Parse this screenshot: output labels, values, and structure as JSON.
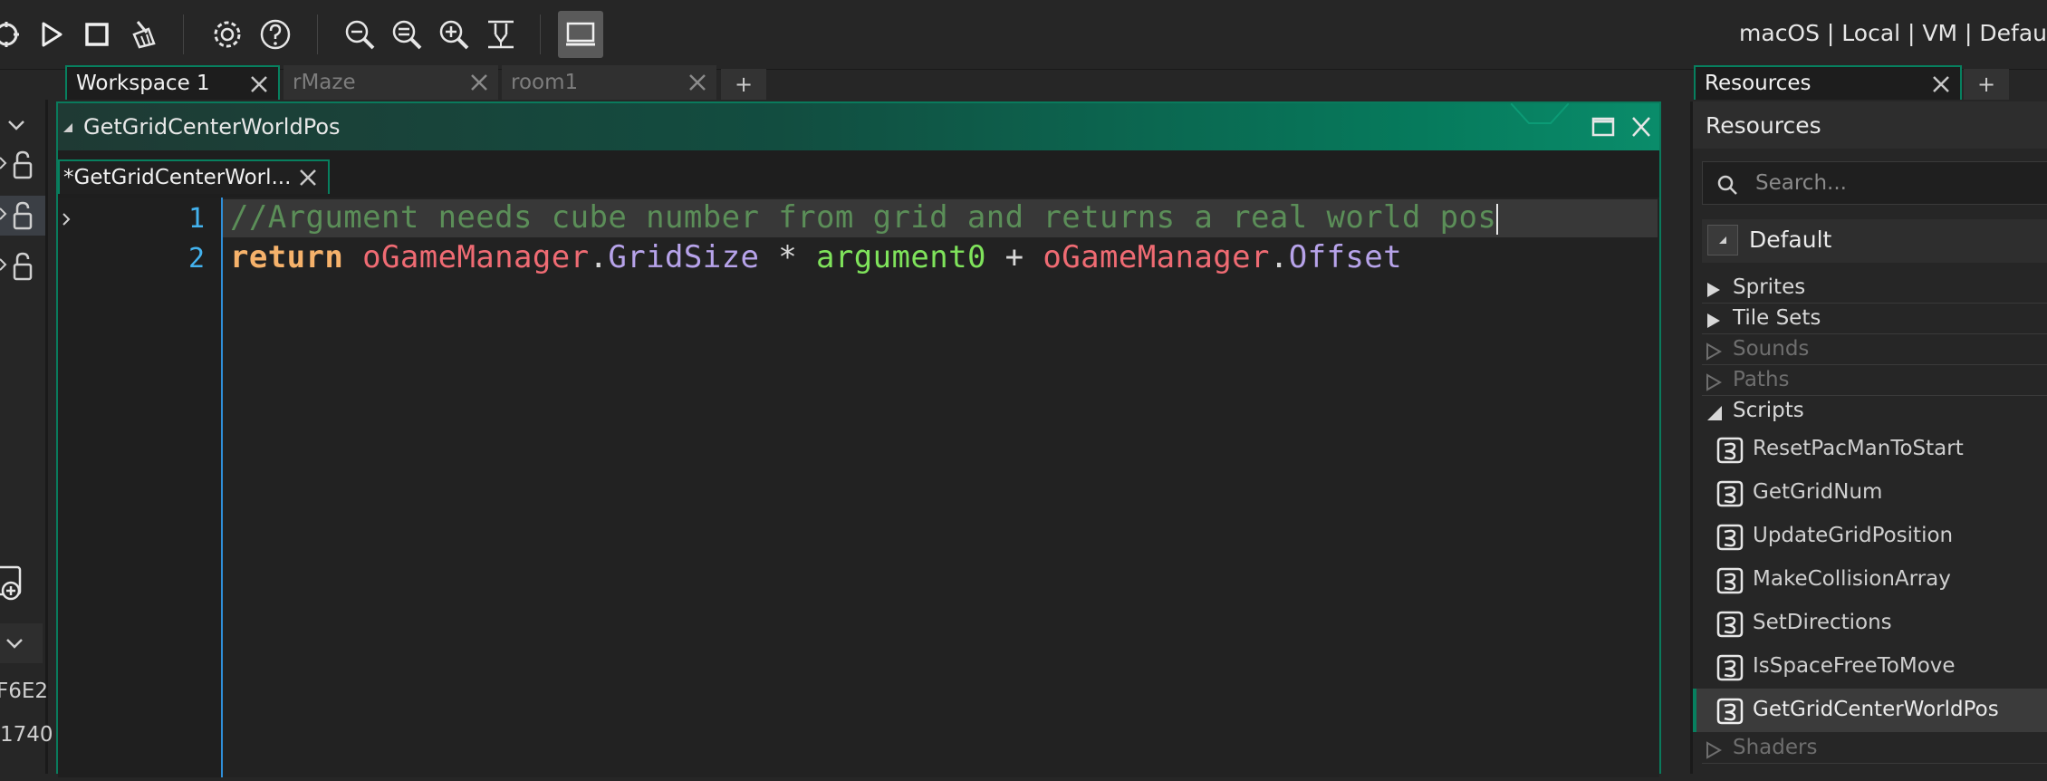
{
  "toolbar": {
    "buttons": [
      "debug-icon",
      "run-icon",
      "stop-icon",
      "clean-icon",
      "settings-icon",
      "help-icon",
      "zoom-out-icon",
      "zoom-reset-icon",
      "zoom-in-icon",
      "fit-icon",
      "monitor-icon"
    ],
    "target_label": "macOS | Local | VM | Defau"
  },
  "workspace_tabs": [
    {
      "label": "Workspace 1",
      "active": true
    },
    {
      "label": "rMaze",
      "active": false
    },
    {
      "label": "room1",
      "active": false
    }
  ],
  "add_tab_label": "+",
  "left_strip": {
    "text1": "F6E2",
    "text2": "1740"
  },
  "editor": {
    "title": "GetGridCenterWorldPos",
    "script_tab": "*GetGridCenterWorl...",
    "line_numbers": [
      "1",
      "2"
    ],
    "line1": {
      "comment": "//Argument needs cube number from grid and returns a real world pos"
    },
    "line2": {
      "kw": "return",
      "obj1": "oGameManager",
      "dot1": ".",
      "var1": "GridSize",
      "op1": " * ",
      "arg": "argument0",
      "op2": " + ",
      "obj2": "oGameManager",
      "dot2": ".",
      "var2": "Offset"
    }
  },
  "resources": {
    "tab_label": "Resources",
    "header": "Resources",
    "search_placeholder": "Search...",
    "default_label": "Default",
    "groups": [
      {
        "label": "Sprites",
        "state": "collapsed",
        "enabled": true
      },
      {
        "label": "Tile Sets",
        "state": "collapsed",
        "enabled": true
      },
      {
        "label": "Sounds",
        "state": "collapsed",
        "enabled": false
      },
      {
        "label": "Paths",
        "state": "collapsed",
        "enabled": false
      },
      {
        "label": "Scripts",
        "state": "expanded",
        "enabled": true
      },
      {
        "label": "Shaders",
        "state": "collapsed",
        "enabled": false
      }
    ],
    "scripts": [
      "ResetPacManToStart",
      "GetGridNum",
      "UpdateGridPosition",
      "MakeCollisionArray",
      "SetDirections",
      "IsSpaceFreeToMove",
      "GetGridCenterWorldPos"
    ],
    "selected_script": "GetGridCenterWorldPos"
  },
  "colors": {
    "accent": "#07805f",
    "comment": "#5b8e58",
    "keyword": "#f6b26b",
    "object": "#ef6b73",
    "variable": "#b7a3ea",
    "argument": "#7fe35b",
    "line_number": "#43b2ee"
  }
}
